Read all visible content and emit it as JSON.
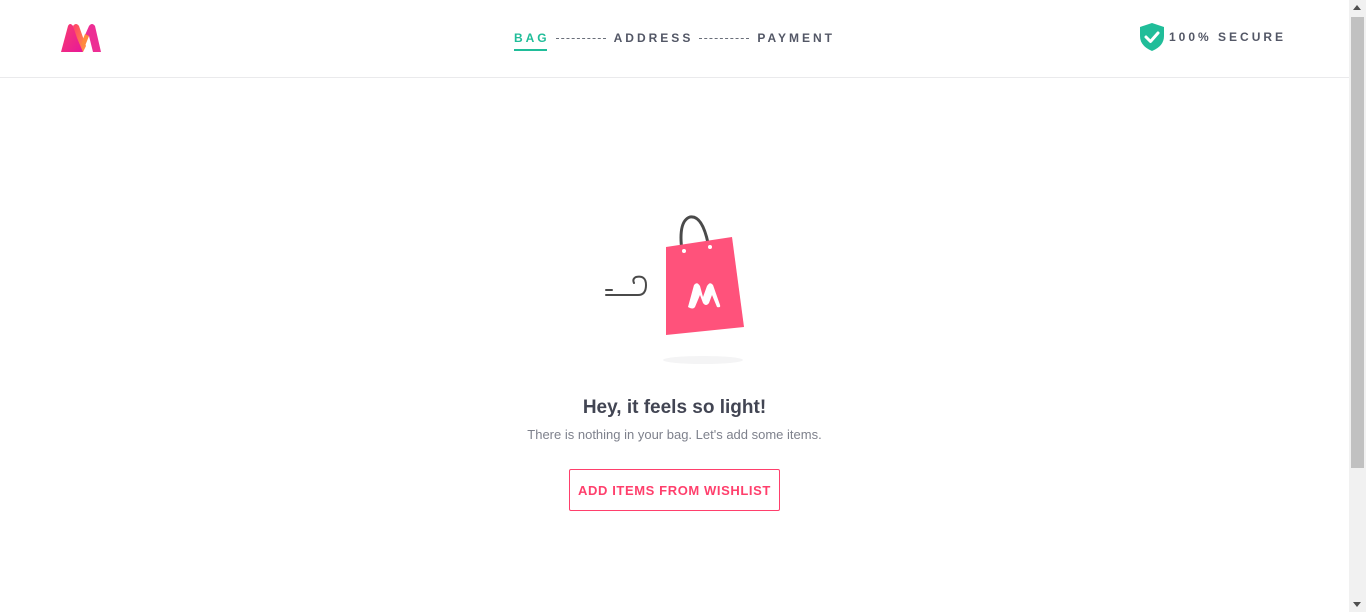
{
  "header": {
    "logo_icon": "myntra-logo-icon",
    "steps": [
      {
        "label": "BAG",
        "active": true
      },
      {
        "label": "ADDRESS",
        "active": false
      },
      {
        "label": "PAYMENT",
        "active": false
      }
    ],
    "secure": {
      "icon": "shield-check-icon",
      "label": "100% SECURE"
    }
  },
  "empty_bag": {
    "illustration_icon": "shopping-bag-icon",
    "title": "Hey, it feels so light!",
    "subtitle": "There is nothing in your bag. Let's add some items.",
    "button_label": "ADD ITEMS FROM WISHLIST"
  },
  "colors": {
    "accent_green": "#20bd99",
    "brand_pink": "#ff3f6c",
    "text_dark": "#424553",
    "text_muted": "#7e818c"
  }
}
